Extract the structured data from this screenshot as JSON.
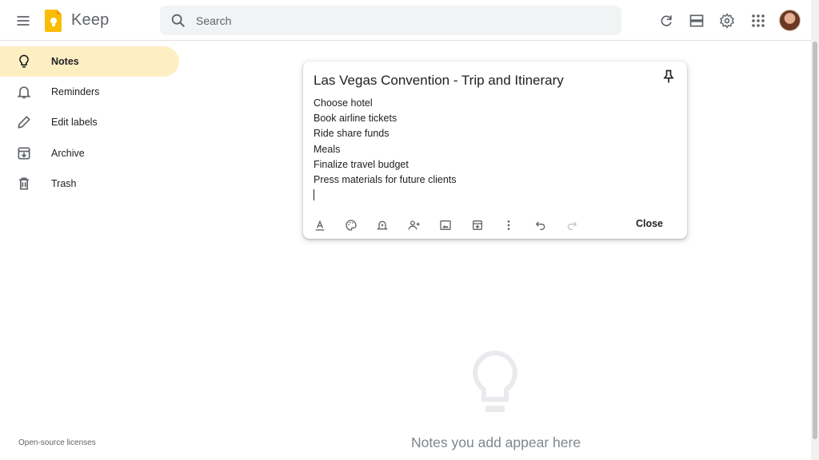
{
  "header": {
    "app_title": "Keep",
    "search_placeholder": "Search"
  },
  "sidebar": {
    "items": [
      {
        "label": "Notes",
        "icon": "lightbulb-icon",
        "active": true
      },
      {
        "label": "Reminders",
        "icon": "bell-icon",
        "active": false
      },
      {
        "label": "Edit labels",
        "icon": "pencil-icon",
        "active": false
      },
      {
        "label": "Archive",
        "icon": "archive-icon",
        "active": false
      },
      {
        "label": "Trash",
        "icon": "trash-icon",
        "active": false
      }
    ],
    "footer_link": "Open-source licenses"
  },
  "note": {
    "title": "Las Vegas Convention - Trip and Itinerary",
    "lines": [
      "Choose hotel",
      "Book airline tickets",
      "Ride share funds",
      "Meals",
      "Finalize travel budget",
      "Press materials for future clients"
    ],
    "toolbar": [
      "text-format-icon",
      "palette-icon",
      "remind-me-icon",
      "collaborator-icon",
      "add-image-icon",
      "archive-icon",
      "more-icon",
      "undo-icon",
      "redo-icon"
    ],
    "close_label": "Close"
  },
  "empty_state": {
    "text": "Notes you add appear here"
  },
  "colors": {
    "accent_active": "#feefc3",
    "logo_yellow": "#fbbc04",
    "search_bg": "#f1f3f4"
  }
}
